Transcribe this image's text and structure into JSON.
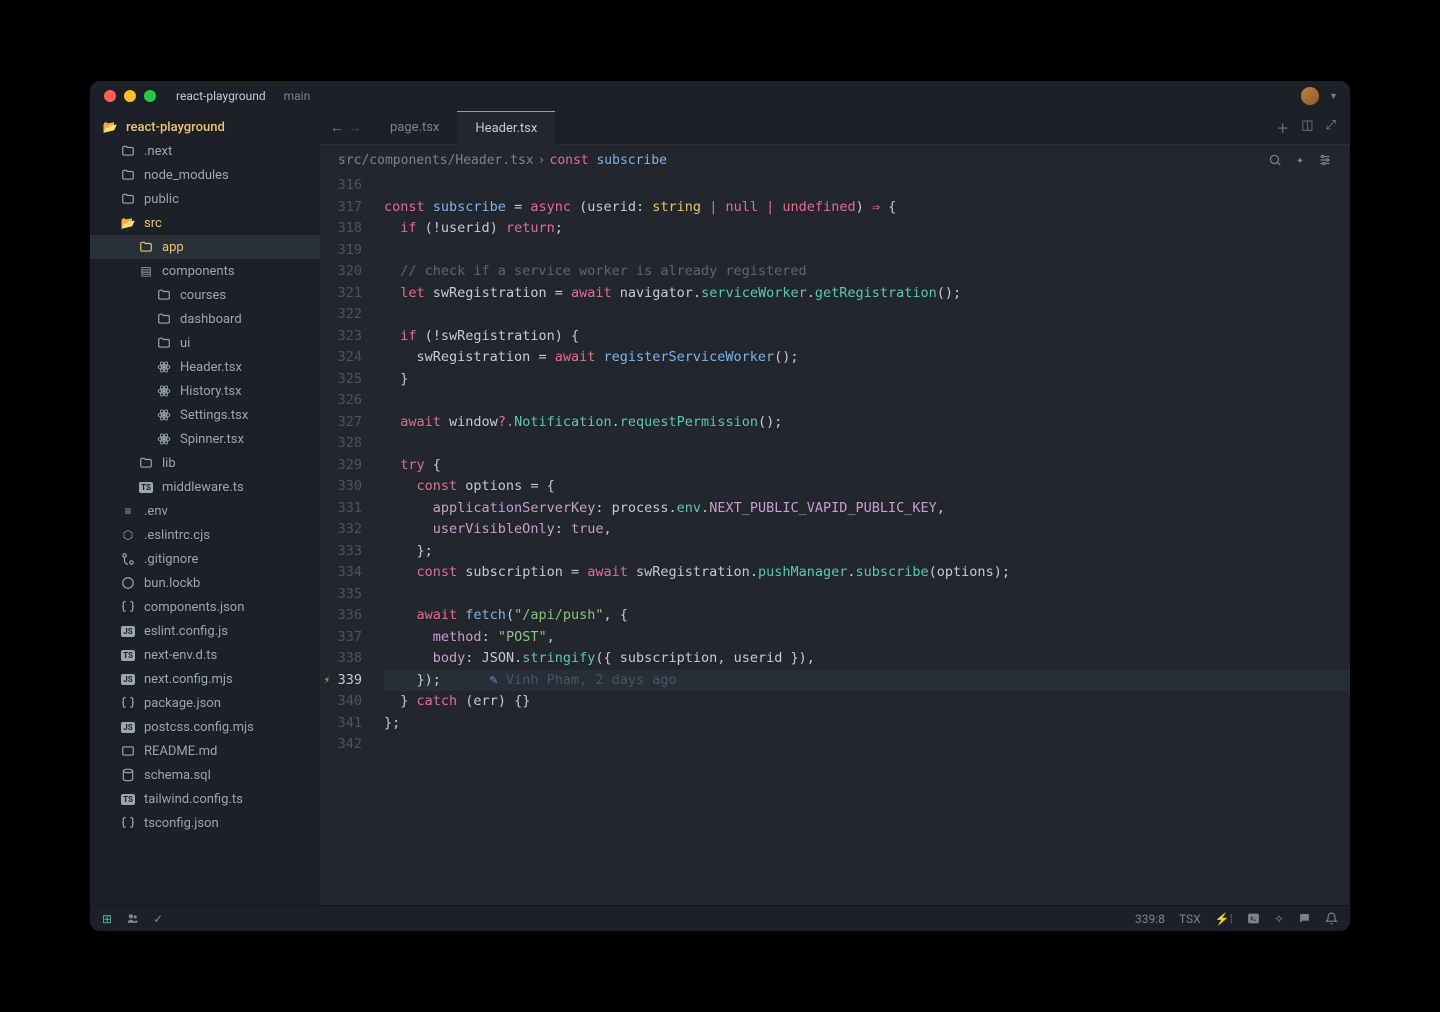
{
  "window": {
    "project": "react-playground",
    "branch": "main"
  },
  "sidebar": {
    "root": "react-playground",
    "items": [
      {
        "label": ".next",
        "icon": "folder",
        "indent": 1
      },
      {
        "label": "node_modules",
        "icon": "folder",
        "indent": 1
      },
      {
        "label": "public",
        "icon": "folder",
        "indent": 1
      },
      {
        "label": "src",
        "icon": "folder-open",
        "indent": 1,
        "highlight": true
      },
      {
        "label": "app",
        "icon": "folder",
        "indent": 2,
        "highlight": true,
        "active": true
      },
      {
        "label": "components",
        "icon": "folder-open-gray",
        "indent": 2
      },
      {
        "label": "courses",
        "icon": "folder",
        "indent": 3
      },
      {
        "label": "dashboard",
        "icon": "folder",
        "indent": 3
      },
      {
        "label": "ui",
        "icon": "folder",
        "indent": 3
      },
      {
        "label": "Header.tsx",
        "icon": "react",
        "indent": 3
      },
      {
        "label": "History.tsx",
        "icon": "react",
        "indent": 3
      },
      {
        "label": "Settings.tsx",
        "icon": "react",
        "indent": 3
      },
      {
        "label": "Spinner.tsx",
        "icon": "react",
        "indent": 3
      },
      {
        "label": "lib",
        "icon": "folder",
        "indent": 2
      },
      {
        "label": "middleware.ts",
        "icon": "ts",
        "indent": 2
      },
      {
        "label": ".env",
        "icon": "env",
        "indent": 1
      },
      {
        "label": ".eslintrc.cjs",
        "icon": "eslint",
        "indent": 1
      },
      {
        "label": ".gitignore",
        "icon": "git",
        "indent": 1
      },
      {
        "label": "bun.lockb",
        "icon": "lock",
        "indent": 1
      },
      {
        "label": "components.json",
        "icon": "json",
        "indent": 1
      },
      {
        "label": "eslint.config.js",
        "icon": "js",
        "indent": 1
      },
      {
        "label": "next-env.d.ts",
        "icon": "ts",
        "indent": 1
      },
      {
        "label": "next.config.mjs",
        "icon": "js",
        "indent": 1
      },
      {
        "label": "package.json",
        "icon": "json",
        "indent": 1
      },
      {
        "label": "postcss.config.mjs",
        "icon": "js",
        "indent": 1
      },
      {
        "label": "README.md",
        "icon": "md",
        "indent": 1
      },
      {
        "label": "schema.sql",
        "icon": "db",
        "indent": 1
      },
      {
        "label": "tailwind.config.ts",
        "icon": "ts",
        "indent": 1
      },
      {
        "label": "tsconfig.json",
        "icon": "json",
        "indent": 1
      }
    ]
  },
  "tabs": [
    {
      "label": "page.tsx",
      "active": false
    },
    {
      "label": "Header.tsx",
      "active": true
    }
  ],
  "breadcrumb": {
    "path": "src/components/Header.tsx",
    "const": "const",
    "symbol": "subscribe"
  },
  "code": {
    "startLine": 316,
    "cursorLine": 339,
    "lines": [
      "",
      "const subscribe = async (userid: string | null | undefined) => {",
      "  if (!userid) return;",
      "",
      "  // check if a service worker is already registered",
      "  let swRegistration = await navigator.serviceWorker.getRegistration();",
      "",
      "  if (!swRegistration) {",
      "    swRegistration = await registerServiceWorker();",
      "  }",
      "",
      "  await window?.Notification.requestPermission();",
      "",
      "  try {",
      "    const options = {",
      "      applicationServerKey: process.env.NEXT_PUBLIC_VAPID_PUBLIC_KEY,",
      "      userVisibleOnly: true,",
      "    };",
      "    const subscription = await swRegistration.pushManager.subscribe(options);",
      "",
      "    await fetch(\"/api/push\", {",
      "      method: \"POST\",",
      "      body: JSON.stringify({ subscription, userid }),",
      "    });",
      "  } catch (err) {}",
      "};",
      ""
    ],
    "blame": {
      "line": 339,
      "author": "Vinh Pham",
      "when": "2 days ago"
    }
  },
  "status": {
    "position": "339:8",
    "lang": "TSX"
  }
}
